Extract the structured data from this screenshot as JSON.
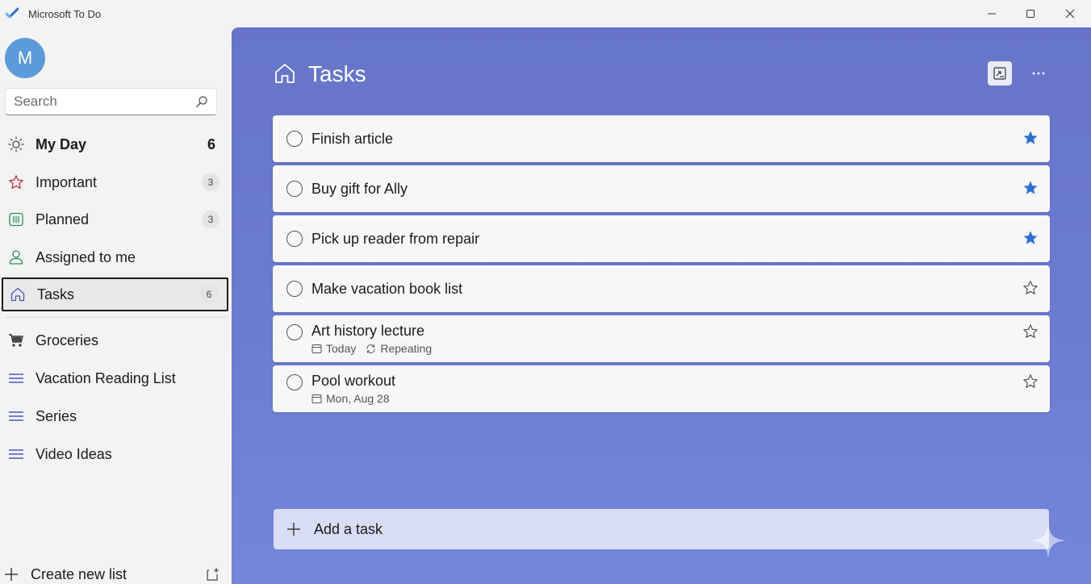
{
  "window": {
    "title": "Microsoft To Do"
  },
  "sidebar": {
    "avatar_initial": "M",
    "search_placeholder": "Search",
    "items": [
      {
        "label": "My Day",
        "count": "6",
        "icon": "sun-icon"
      },
      {
        "label": "Important",
        "count": "3",
        "icon": "star-icon"
      },
      {
        "label": "Planned",
        "count": "3",
        "icon": "calendar-icon"
      },
      {
        "label": "Assigned to me",
        "count": "",
        "icon": "person-icon"
      },
      {
        "label": "Tasks",
        "count": "6",
        "icon": "home-icon"
      }
    ],
    "lists": [
      {
        "label": "Groceries",
        "icon": "cart-icon"
      },
      {
        "label": "Vacation Reading List",
        "icon": "list-icon"
      },
      {
        "label": "Series",
        "icon": "list-icon"
      },
      {
        "label": "Video Ideas",
        "icon": "list-icon"
      }
    ],
    "create_list_label": "Create new list"
  },
  "main": {
    "title": "Tasks",
    "add_task_label": "Add a task",
    "tasks": [
      {
        "title": "Finish article",
        "important": true
      },
      {
        "title": "Buy gift for Ally",
        "important": true
      },
      {
        "title": "Pick up reader from repair",
        "important": true
      },
      {
        "title": "Make vacation book list",
        "important": false
      },
      {
        "title": "Art history lecture",
        "important": false,
        "due": "Today",
        "repeat": "Repeating"
      },
      {
        "title": "Pool workout",
        "important": false,
        "due": "Mon, Aug 28"
      }
    ]
  },
  "colors": {
    "accent_blue": "#2f6fd1",
    "main_background": "#6675c7",
    "avatar": "#5b9bd9",
    "important_red": "#c4314b",
    "planned_green": "#2e8b57"
  }
}
